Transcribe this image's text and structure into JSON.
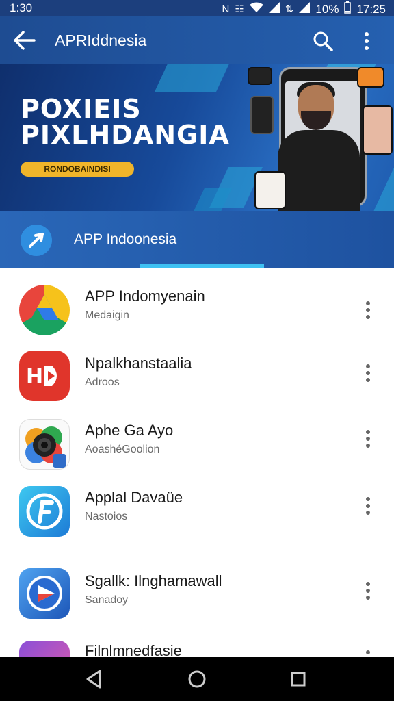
{
  "status_bar": {
    "time_left": "1:30",
    "battery": "10%",
    "time_right": "17:25"
  },
  "app_bar": {
    "title": "APRIddnesia"
  },
  "banner": {
    "title_line1": "POXIEIS",
    "title_line2": "PIXLHDANGIA",
    "badge": "RONDOBAINDISI"
  },
  "tab": {
    "label": "APP Indoonesia"
  },
  "apps": [
    {
      "name": "APP Indomyenain",
      "subtitle": "Medaigin"
    },
    {
      "name": "Npalkhanstaalia",
      "subtitle": "Adroos"
    },
    {
      "name": "Aphe Ga Ayo",
      "subtitle": "AoashéGoolion"
    },
    {
      "name": "Applal Davaüe",
      "subtitle": "Nastoios"
    },
    {
      "name": "Sgallk: Ilnghamawall",
      "subtitle": "Sanadoy"
    },
    {
      "name": "Filnlmnedfasie",
      "subtitle": ""
    }
  ],
  "colors": {
    "app_bar": "#2560b0",
    "tab_indicator": "#3ec1f2",
    "badge": "#f0b52a"
  }
}
